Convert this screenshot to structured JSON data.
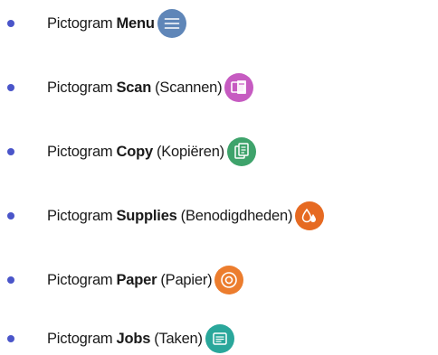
{
  "colors": {
    "bullet": "#4a55c9",
    "menu": "#5f86b8",
    "scan": "#c65bc1",
    "copy": "#3ea36b",
    "supplies": "#e66a22",
    "paper": "#ec7d2e",
    "jobs": "#2aa79b"
  },
  "items": [
    {
      "lead": "Pictogram",
      "name": "Menu",
      "paren": "",
      "icon": "menu-icon"
    },
    {
      "lead": "Pictogram",
      "name": "Scan",
      "paren": "(Scannen)",
      "icon": "scan-icon"
    },
    {
      "lead": "Pictogram",
      "name": "Copy",
      "paren": "(Kopiëren)",
      "icon": "copy-icon"
    },
    {
      "lead": "Pictogram",
      "name": "Supplies",
      "paren": "(Benodigdheden)",
      "icon": "supplies-icon"
    },
    {
      "lead": "Pictogram",
      "name": "Paper",
      "paren": "(Papier)",
      "icon": "paper-icon"
    },
    {
      "lead": "Pictogram",
      "name": "Jobs",
      "paren": "(Taken)",
      "icon": "jobs-icon"
    }
  ]
}
